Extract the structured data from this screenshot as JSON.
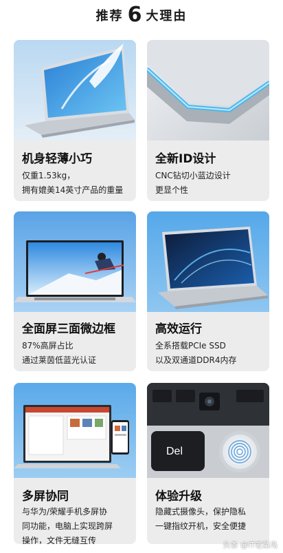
{
  "header": {
    "prefix": "推荐",
    "number": "6",
    "suffix": "大理由"
  },
  "cards": [
    {
      "title": "机身轻薄小巧",
      "lines": [
        "仅重1.53kg，",
        "拥有媲美14英寸产品的重量"
      ]
    },
    {
      "title": "全新ID设计",
      "lines": [
        "CNC钻切小蓝边设计",
        "更显个性"
      ]
    },
    {
      "title": "全面屏三面微边框",
      "lines": [
        "87%高屏占比",
        "通过莱茵低蓝光认证"
      ]
    },
    {
      "title": "高效运行",
      "lines": [
        "全系搭载PCIe SSD",
        "以及双通道DDR4内存"
      ]
    },
    {
      "title": "多屏协同",
      "lines": [
        "与华为/荣耀手机多屏协",
        "同功能，电脑上实现跨屏",
        "操作，文件无缝互传"
      ]
    },
    {
      "title": "体验升级",
      "lines": [
        "隐藏式摄像头，保护隐私",
        "一键指纹开机，安全便捷"
      ]
    }
  ],
  "images": {
    "key_label": "Del"
  },
  "watermark": "头条 @IT老菜鸟",
  "colors": {
    "card_bg": "#ececec",
    "accent_blue": "#4aa8e8"
  }
}
